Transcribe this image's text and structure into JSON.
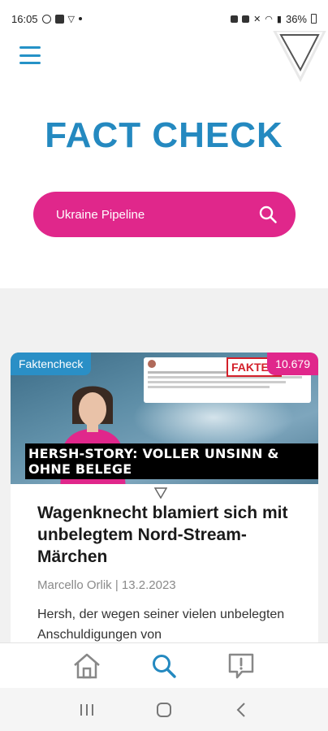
{
  "status_bar": {
    "time": "16:05",
    "battery": "36%"
  },
  "page": {
    "title": "FACT CHECK"
  },
  "search": {
    "value": "Ukraine Pipeline"
  },
  "card": {
    "category": "Faktencheck",
    "count": "10.679",
    "stamp": "FAKTEN",
    "image_headline": "HERSH-STORY: VOLLER UNSINN & OHNE BELEGE",
    "title": "Wagenknecht blamiert sich mit unbelegtem Nord-Stream-Märchen",
    "meta": "Marcello Orlik | 13.2.2023",
    "excerpt": "Hersh, der wegen seiner vielen unbelegten Anschuldigungen von"
  },
  "colors": {
    "accent_blue": "#2489c0",
    "accent_pink": "#e0278b",
    "stamp_red": "#d3202a"
  },
  "bottom_nav": {
    "items": [
      "home-icon",
      "search-icon",
      "report-icon"
    ],
    "active": "search-icon"
  },
  "system_nav": {
    "items": [
      "recent-apps-icon",
      "home-circle-icon",
      "back-icon"
    ]
  }
}
